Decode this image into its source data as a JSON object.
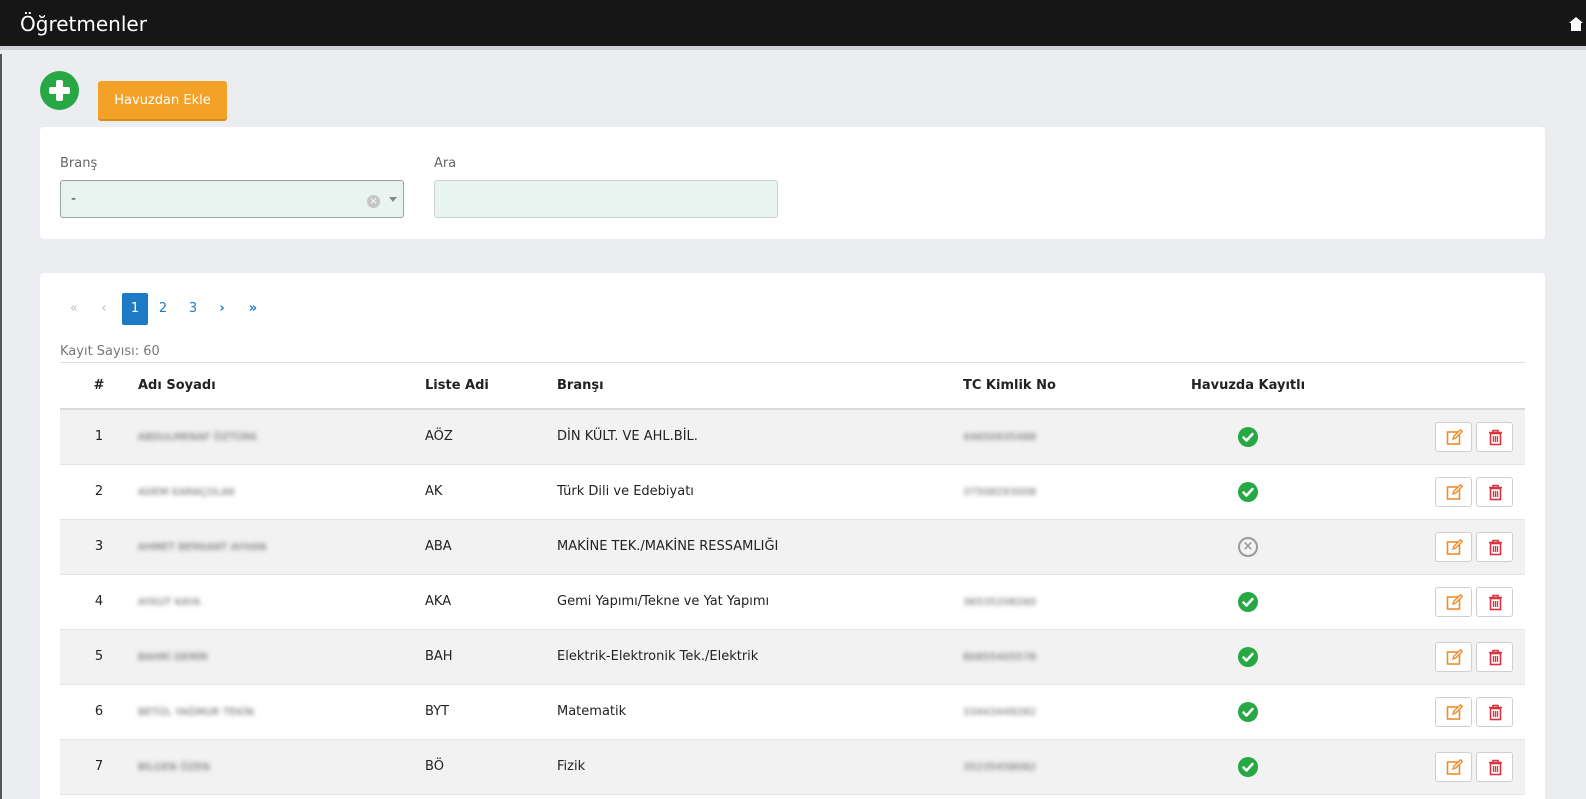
{
  "header": {
    "title": "Öğretmenler",
    "home_icon": "home-icon"
  },
  "toolbar": {
    "add_icon": "plus-circle-icon",
    "pool_label": "Havuzdan Ekle"
  },
  "filters": {
    "branch_label": "Branş",
    "branch_value": "-",
    "search_label": "Ara",
    "search_value": ""
  },
  "pager": {
    "first": "«",
    "prev": "‹",
    "pages": [
      "1",
      "2",
      "3"
    ],
    "active": "1",
    "next": "›",
    "last": "»"
  },
  "record_count": "Kayıt Sayısı: 60",
  "table": {
    "headers": [
      "#",
      "Adı Soyadı",
      "Liste Adi",
      "Branşı",
      "TC Kimlik No",
      "Havuzda Kayıtlı",
      ""
    ],
    "rows": [
      {
        "num": "1",
        "name": "ABDULMENAF ÖZTÜRK",
        "list": "AÖZ",
        "branch": "DİN KÜLT. VE AHL.BİL.",
        "tc": "44650935488",
        "pool": true
      },
      {
        "num": "2",
        "name": "ADEM KARAÇOLAK",
        "list": "AK",
        "branch": "Türk Dili ve Edebiyatı",
        "tc": "37508293008",
        "pool": true
      },
      {
        "num": "3",
        "name": "AHMET BERKANT AYHAN",
        "list": "ABA",
        "branch": "MAKİNE TEK./MAKİNE RESSAMLIĞI",
        "tc": "",
        "pool": false
      },
      {
        "num": "4",
        "name": "AYKUT KAYA",
        "list": "AKA",
        "branch": "Gemi Yapımı/Tekne ve Yat Yapımı",
        "tc": "36535208260",
        "pool": true
      },
      {
        "num": "5",
        "name": "BAHRİ DEMİR",
        "list": "BAH",
        "branch": "Elektrik-Elektronik Tek./Elektrik",
        "tc": "80855405578",
        "pool": true
      },
      {
        "num": "6",
        "name": "BETÜL YAĞMUR TEKİN",
        "list": "BYT",
        "branch": "Matematik",
        "tc": "33443449282",
        "pool": true
      },
      {
        "num": "7",
        "name": "BİLGEN ÖZEN",
        "list": "BÖ",
        "branch": "Fizik",
        "tc": "35235458082",
        "pool": true
      }
    ],
    "edit_icon": "edit-icon",
    "delete_icon": "trash-icon"
  },
  "colors": {
    "topbar": "#161616",
    "add": "#27a844",
    "pool_button": "#f3a127",
    "primary": "#1d7bc6",
    "danger": "#d9343f",
    "edit": "#f08c2b"
  }
}
